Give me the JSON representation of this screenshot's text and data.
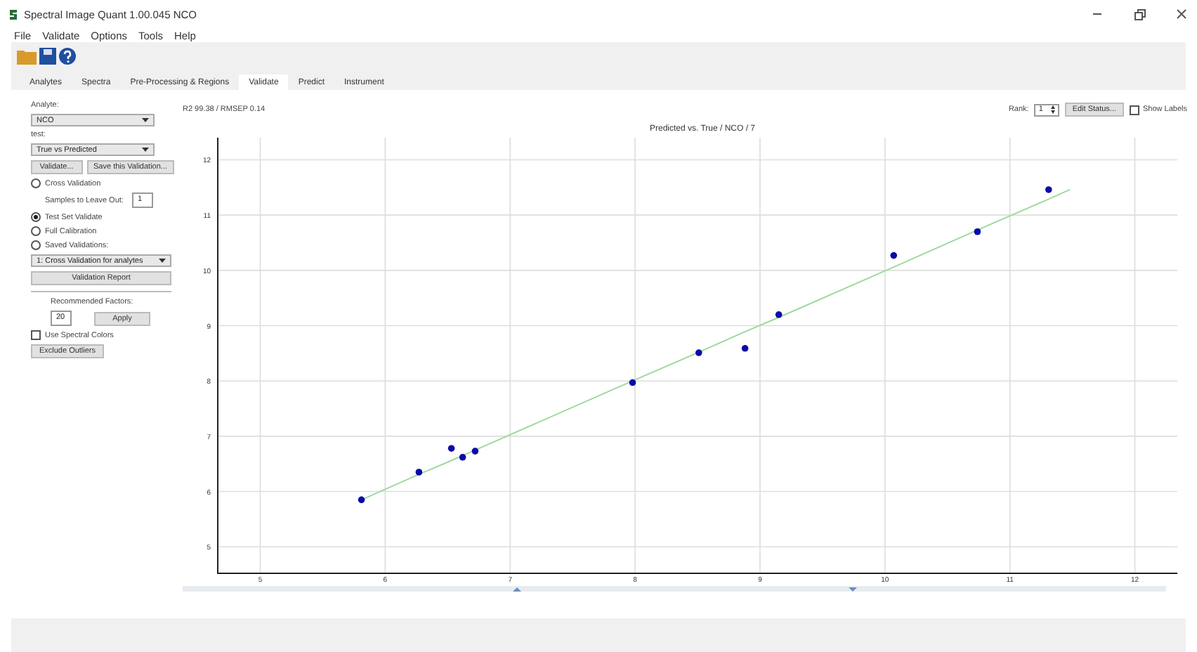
{
  "window": {
    "title": "Spectral Image Quant 1.00.045 NCO"
  },
  "menu": [
    "File",
    "Validate",
    "Options",
    "Tools",
    "Help"
  ],
  "tabs": [
    {
      "label": "Analytes",
      "selected": false
    },
    {
      "label": "Spectra",
      "selected": false
    },
    {
      "label": "Pre-Processing & Regions",
      "selected": false
    },
    {
      "label": "Validate",
      "selected": true
    },
    {
      "label": "Predict",
      "selected": false
    },
    {
      "label": "Instrument",
      "selected": false
    }
  ],
  "left_panel": {
    "analyte_label": "Analyte:",
    "analyte": "NCO",
    "test_label": "test:",
    "test": "True vs Predicted",
    "validate_button": "Validate...",
    "save_button": "Save this Validation...",
    "modes": [
      {
        "label": "Cross Validation",
        "selected": false
      },
      {
        "label": "Test Set Validate",
        "selected": true
      },
      {
        "label": "Full Calibration",
        "selected": false
      },
      {
        "label": "Saved Validations:",
        "selected": false
      }
    ],
    "samples_label": "Samples to Leave Out:",
    "samples_value": "1",
    "saved_dropdown": "1: Cross Validation for analytes",
    "report_button": "Validation Report",
    "factors_label": "Recommended Factors:",
    "factors_value": "20",
    "apply_button": "Apply",
    "spectral_colors": {
      "label": "Use Spectral Colors",
      "checked": false
    },
    "exclude_button": "Exclude Outliers"
  },
  "chart_header": {
    "stats": "R2 99.38 / RMSEP 0.14",
    "rank_label": "Rank:",
    "rank_value": "1",
    "edit_button": "Edit Status...",
    "show_labels": {
      "label": "Show Labels",
      "checked": false
    }
  },
  "chart_data": {
    "type": "scatter",
    "title": "Predicted vs. True / NCO / 7",
    "x": [
      5.81,
      6.27,
      6.53,
      6.62,
      6.72,
      7.98,
      8.51,
      8.88,
      9.15,
      10.07,
      10.74,
      11.31,
      11.48
    ],
    "series": [
      {
        "color": "#0a0aa8",
        "values": [
          5.85,
          6.35,
          6.78,
          6.62,
          6.73,
          7.97,
          8.51,
          8.59,
          9.2,
          10.27,
          10.7,
          11.46,
          null
        ]
      },
      {
        "type": "line",
        "color": "#9ed99e",
        "values": [
          5.85,
          6.31,
          6.56,
          6.65,
          6.75,
          8.0,
          8.52,
          8.89,
          9.15,
          10.06,
          10.73,
          11.29,
          11.46
        ]
      }
    ],
    "xlim": [
      4.66,
      12.34
    ],
    "ylim": [
      4.52,
      12.4
    ],
    "xticks": [
      5,
      6,
      7,
      8,
      9,
      10,
      11,
      12
    ],
    "yticks": [
      5,
      6,
      7,
      8,
      9,
      10,
      11,
      12
    ],
    "grid": true
  }
}
